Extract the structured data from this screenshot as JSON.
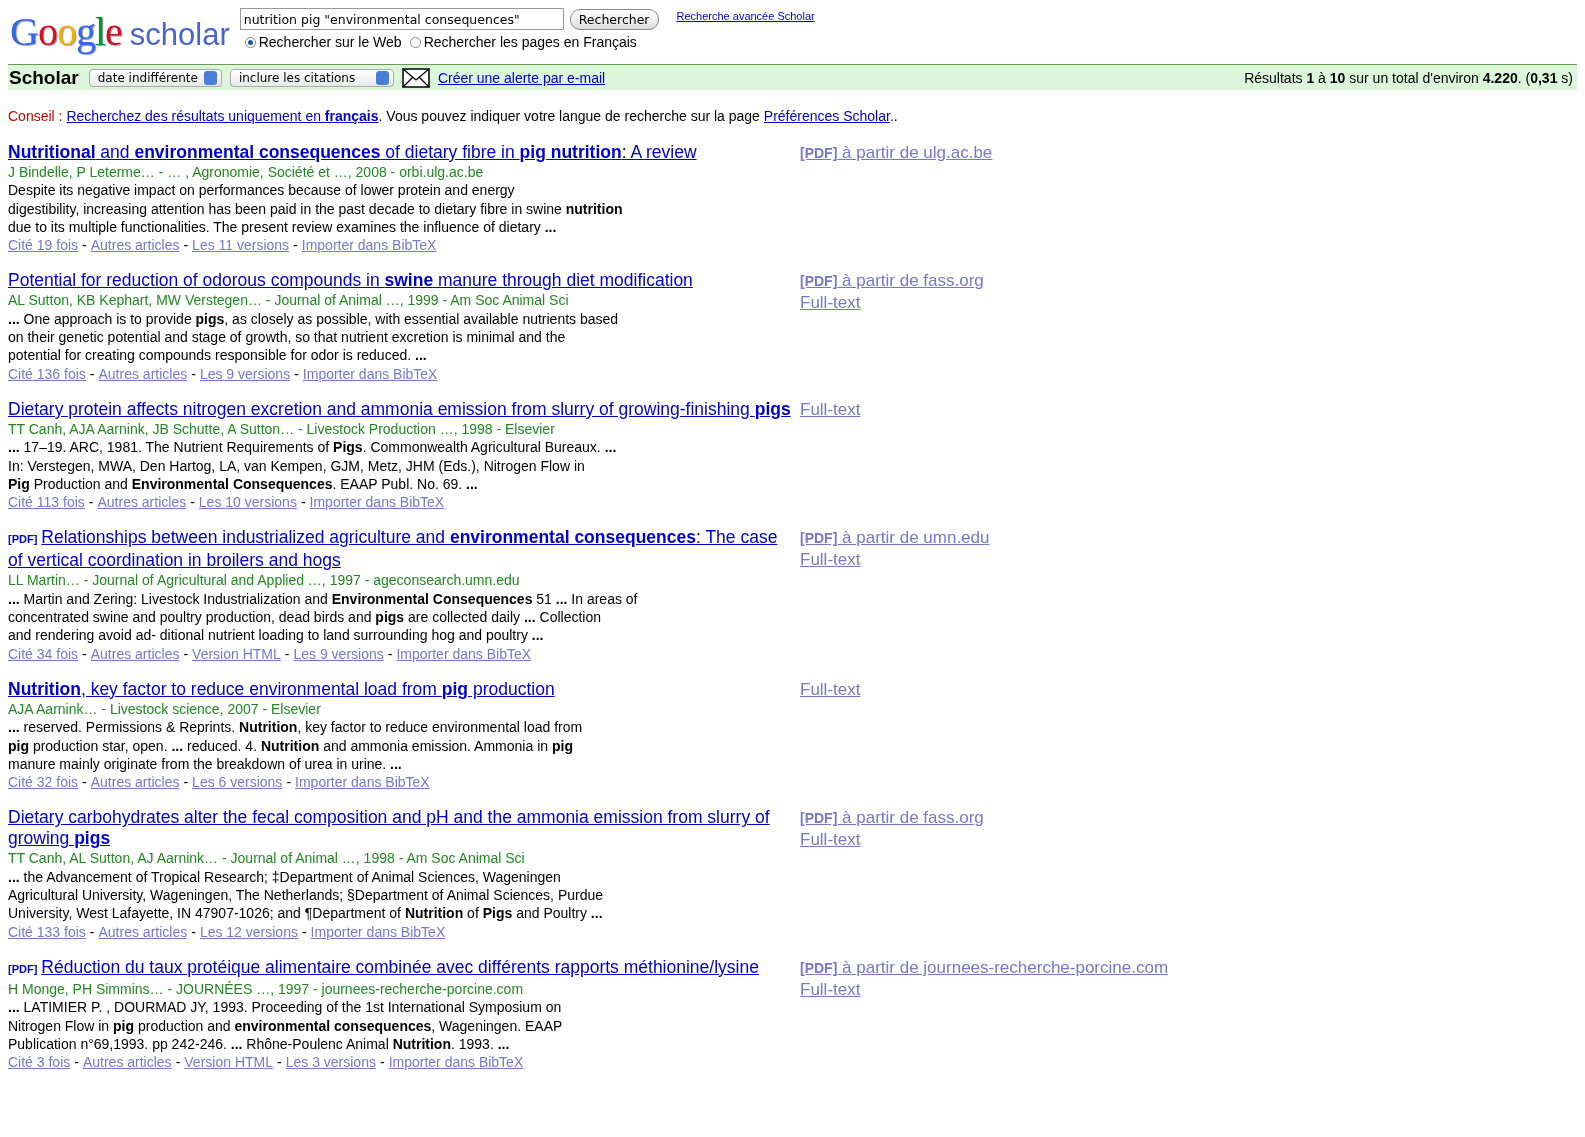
{
  "header": {
    "logo": "Google",
    "logo_suffix": "scholar",
    "search": {
      "value": "nutrition pig \"environmental consequences\""
    },
    "search_button": "Rechercher",
    "advanced_link": "Recherche avancée Scholar",
    "scope": [
      {
        "label": "Rechercher sur le Web",
        "selected": true
      },
      {
        "label": "Rechercher les pages en Français",
        "selected": false
      }
    ]
  },
  "bar": {
    "title": "Scholar",
    "filters": [
      "date indifférente",
      "inclure les citations"
    ],
    "alert_link": "Créer une alerte par e-mail",
    "summary": "Résultats **1** à **10** sur un total d'environ **4.220**. (**0,31** s)"
  },
  "tip": {
    "label": "Conseil :",
    "link": "Recherchez des résultats uniquement en **français**",
    "text": ". Vous pouvez indiquer votre langue de recherche sur la page",
    "pref_link": "Préférences Scholar",
    "end": ".."
  },
  "results": [
    {
      "title": "**Nutritional** and **environmental consequences** of dietary fibre in **pig nutrition**: A review",
      "source": "J Bindelle, P Leterme… - … , Agronomie, Société et …, 2008 - orbi.ulg.ac.be",
      "snippet_lines": [
        "Despite its negative impact on performances because of lower protein and energy",
        "digestibility, increasing attention has been paid in the past decade to dietary fibre in swine **nutrition**",
        "due to its multiple functionalities. The present review examines the influence of dietary **...**"
      ],
      "links": [
        {
          "text": "Cité 19 fois"
        },
        {
          "sep": "-",
          "text": "Autres articles"
        },
        {
          "sep": "-",
          "text": "Les 11 versions"
        },
        {
          "sep": "-",
          "text": "Importer dans BibTeX"
        }
      ],
      "side": [
        {
          "tag": "[PDF]",
          "text": "à partir de ulg.ac.be"
        }
      ]
    },
    {
      "title": "Potential for reduction of odorous compounds in **swine** manure through diet modification",
      "source": "AL Sutton, KB Kephart, MW Verstegen… - Journal of Animal …, 1999 - Am Soc Animal Sci",
      "snippet_lines": [
        "**...** One approach is to provide **pigs**, as closely as possible, with essential available nutrients based",
        "on their genetic potential and stage of growth, so that nutrient excretion is minimal and the",
        "potential for creating compounds responsible for odor is reduced. **...**"
      ],
      "links": [
        {
          "text": "Cité 136 fois"
        },
        {
          "sep": "-",
          "text": "Autres articles"
        },
        {
          "sep": "-",
          "text": "Les 9 versions"
        },
        {
          "sep": "-",
          "text": "Importer dans BibTeX"
        }
      ],
      "side": [
        {
          "tag": "[PDF]",
          "text": "à partir de fass.org"
        },
        {
          "text": "Full-text"
        }
      ]
    },
    {
      "title": "Dietary protein affects nitrogen excretion and ammonia emission from slurry of growing-finishing **pigs**",
      "source": "TT Canh, AJA Aarnink, JB Schutte, A Sutton… - Livestock Production …, 1998 - Elsevier",
      "snippet_lines": [
        "**...** 17–19. ARC, 1981. The Nutrient Requirements of **Pigs**. Commonwealth Agricultural Bureaux. **...**",
        "In: Verstegen, MWA, Den Hartog, LA, van Kempen, GJM, Metz, JHM (Eds.), Nitrogen Flow in",
        "**Pig** Production and **Environmental Consequences**. EAAP Publ. No. 69. **...**"
      ],
      "links": [
        {
          "text": "Cité 113 fois"
        },
        {
          "sep": "-",
          "text": "Autres articles"
        },
        {
          "sep": "-",
          "text": "Les 10 versions"
        },
        {
          "sep": "-",
          "text": "Importer dans BibTeX"
        }
      ],
      "side": [
        {
          "text": "Full-text"
        }
      ]
    },
    {
      "tag": "[PDF]",
      "title": "Relationships between industrialized agriculture and **environmental consequences**: The case of vertical coordination in broilers and hogs",
      "source": "LL Martin… - Journal of Agricultural and Applied …, 1997 - ageconsearch.umn.edu",
      "snippet_lines": [
        "**...** Martin and Zering: Livestock Industrialization and **Environmental Consequences** 51 **...** In areas of",
        "concentrated swine and poultry production, dead birds and **pigs** are collected daily **...** Collection",
        "and rendering avoid ad- ditional nutrient loading to land surrounding hog and poultry **...**"
      ],
      "links": [
        {
          "text": "Cité 34 fois"
        },
        {
          "sep": "-",
          "text": "Autres articles"
        },
        {
          "sep": "-",
          "text": "Version HTML"
        },
        {
          "sep": "-",
          "text": "Les 9 versions"
        },
        {
          "sep": "-",
          "text": "Importer dans BibTeX"
        }
      ],
      "side": [
        {
          "tag": "[PDF]",
          "text": "à partir de umn.edu"
        },
        {
          "text": "Full-text"
        }
      ]
    },
    {
      "title": "**Nutrition**, key factor to reduce environmental load from **pig** production",
      "source": "AJA Aarnink… - Livestock science, 2007 - Elsevier",
      "snippet_lines": [
        "**...** reserved. Permissions & Reprints. **Nutrition**, key factor to reduce environmental load from",
        "**pig** production star, open. **...** reduced. 4. **Nutrition** and ammonia emission. Ammonia in **pig**",
        "manure mainly originate from the breakdown of urea in urine. **...**"
      ],
      "links": [
        {
          "text": "Cité 32 fois"
        },
        {
          "sep": "-",
          "text": "Autres articles"
        },
        {
          "sep": "-",
          "text": "Les 6 versions"
        },
        {
          "sep": "-",
          "text": "Importer dans BibTeX"
        }
      ],
      "side": [
        {
          "text": "Full-text"
        }
      ]
    },
    {
      "title": "Dietary carbohydrates alter the fecal composition and pH and the ammonia emission from slurry of growing **pigs**",
      "source": "TT Canh, AL Sutton, AJ Aarnink… - Journal of Animal …, 1998 - Am Soc Animal Sci",
      "snippet_lines": [
        "**...** the Advancement of Tropical Research; ‡Department of Animal Sciences, Wageningen",
        "Agricultural University, Wageningen, The Netherlands; §Department of Animal Sciences, Purdue",
        "University, West Lafayette, IN 47907-1026; and ¶Department of **Nutrition** of **Pigs** and Poultry **...**"
      ],
      "links": [
        {
          "text": "Cité 133 fois"
        },
        {
          "sep": "-",
          "text": "Autres articles"
        },
        {
          "sep": "-",
          "text": "Les 12 versions"
        },
        {
          "sep": "-",
          "text": "Importer dans BibTeX"
        }
      ],
      "side": [
        {
          "tag": "[PDF]",
          "text": "à partir de fass.org"
        },
        {
          "text": "Full-text"
        }
      ]
    },
    {
      "tag": "[PDF]",
      "title": "Réduction du taux protéique alimentaire combinée avec différents rapports méthionine/lysine",
      "source": "H Monge, PH Simmins… - JOURNÉES …, 1997 - journees-recherche-porcine.com",
      "snippet_lines": [
        "**...** LATIMIER P. , DOURMAD JY, 1993. Proceeding of the 1st International Symposium on",
        "Nitrogen Flow in **pig** production and **environmental consequences**, Wageningen. EAAP",
        "Publication n°69,1993. pp 242-246. **...** Rhône-Poulenc Animal **Nutrition**. 1993. **...**"
      ],
      "links": [
        {
          "text": "Cité 3 fois"
        },
        {
          "sep": "-",
          "text": "Autres articles"
        },
        {
          "sep": "-",
          "text": "Version HTML"
        },
        {
          "sep": "-",
          "text": "Les 3 versions"
        },
        {
          "sep": "-",
          "text": "Importer dans BibTeX"
        }
      ],
      "side": [
        {
          "tag": "[PDF]",
          "text": "à partir de journees-recherche-porcine.com"
        },
        {
          "text": "Full-text"
        }
      ]
    }
  ]
}
